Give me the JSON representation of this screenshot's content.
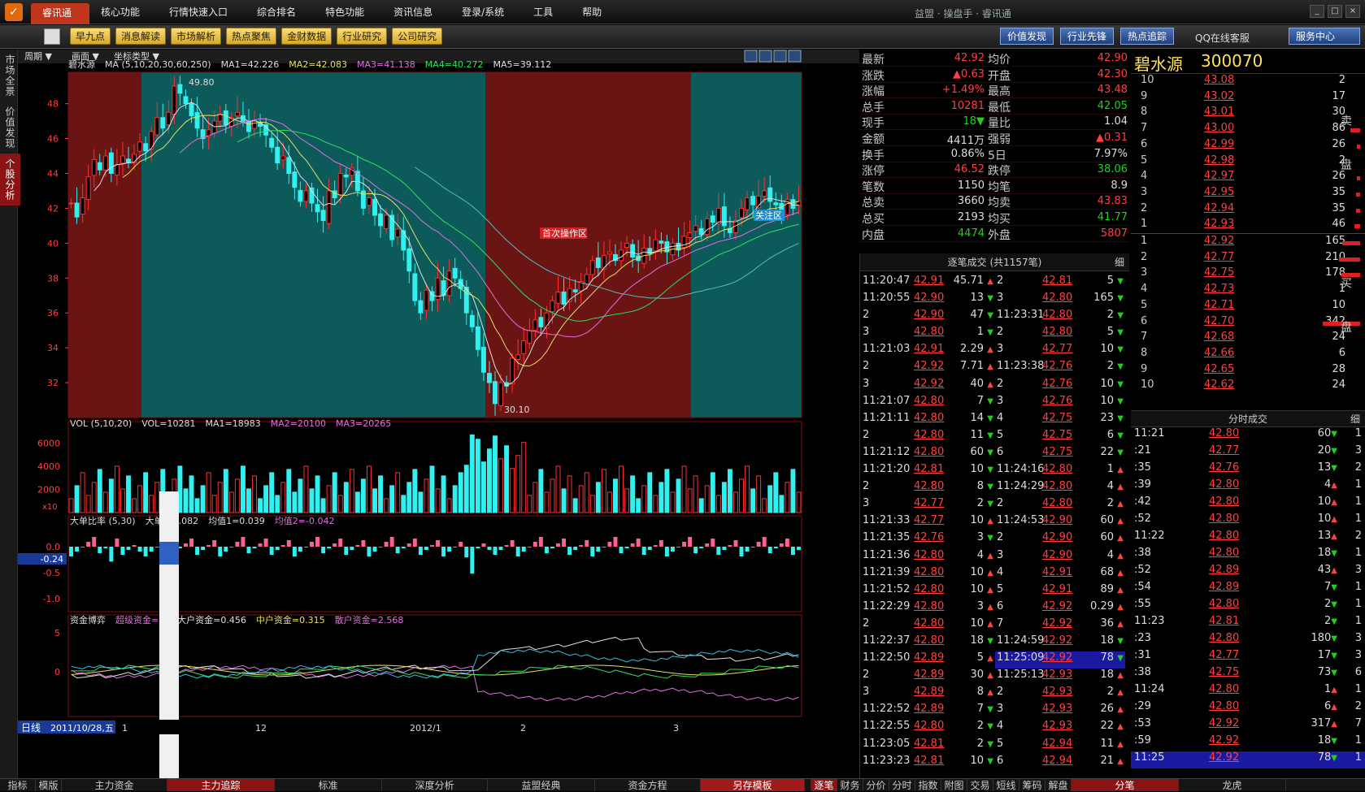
{
  "titlebar": {
    "menu": [
      "睿讯通",
      "核心功能",
      "行情快速入口",
      "综合排名",
      "特色功能",
      "资讯信息",
      "登录/系统",
      "工具",
      "帮助"
    ],
    "app_title": "益盟 · 操盘手 · 睿讯通"
  },
  "toolbar": {
    "quick": [
      "早九点",
      "消息解读",
      "市场解析",
      "热点聚焦",
      "金财数据",
      "行业研究",
      "公司研究"
    ],
    "right": [
      "价值发现",
      "行业先锋",
      "热点追踪"
    ],
    "qq": "QQ在线客服",
    "service": "服务中心"
  },
  "left_tabs": [
    "市场全景",
    "价值发现",
    "个股分析"
  ],
  "chart_toolbar": {
    "period": "周期",
    "picture": "画面",
    "coord": "坐标类型"
  },
  "chart": {
    "ma_header": [
      {
        "text": "碧水源",
        "color": "#ddd"
      },
      {
        "text": "MA (5,10,20,30,60,250)",
        "color": "#ddd"
      },
      {
        "text": "MA1=42.226",
        "color": "#ddd"
      },
      {
        "text": "MA2=42.083",
        "color": "#e8e060"
      },
      {
        "text": "MA3=41.138",
        "color": "#e070e0"
      },
      {
        "text": "MA4=40.272",
        "color": "#30e060"
      },
      {
        "text": "MA5=39.112",
        "color": "#e0e0e0"
      }
    ],
    "y_labels": [
      "48",
      "46",
      "44",
      "42",
      "40",
      "38",
      "36",
      "34",
      "32"
    ],
    "high_label": "49.80",
    "low_label": "30.10",
    "zone_label": "首次操作区",
    "watch_label": "关注区",
    "vol_header": [
      {
        "text": "VOL (5,10,20)",
        "color": "#ddd"
      },
      {
        "text": "VOL=10281",
        "color": "#ddd"
      },
      {
        "text": "MA1=18983",
        "color": "#ddd"
      },
      {
        "text": "MA2=20100",
        "color": "#e070e0"
      },
      {
        "text": "MA3=20265",
        "color": "#e070e0"
      }
    ],
    "vol_y_labels": [
      "6000",
      "4000",
      "2000"
    ],
    "vol_unit": "x10",
    "big_header": [
      {
        "text": "大单比率 (5,30)",
        "color": "#ddd"
      },
      {
        "text": "大单",
        "color": "#ddd"
      },
      {
        "text": "0.082",
        "color": "#ddd"
      },
      {
        "text": "均值1=0.039",
        "color": "#ddd"
      },
      {
        "text": "均值2=-0.042",
        "color": "#e070e0"
      }
    ],
    "big_y_labels": [
      "0.0",
      "-0.5",
      "-1.0"
    ],
    "big_current": "-0.24",
    "fund_header": [
      {
        "text": "资金博弈",
        "color": "#ddd"
      },
      {
        "text": "超级资金=-3",
        "color": "#e070e0"
      },
      {
        "text": "大户资金=0.456",
        "color": "#e0e0e0"
      },
      {
        "text": "中户资金=0.315",
        "color": "#e8e060"
      },
      {
        "text": "散户资金=2.568",
        "color": "#e070e0"
      }
    ],
    "fund_y_labels": [
      "5",
      "0"
    ],
    "x_axis": {
      "period": "日线",
      "date": "2011/10/28,五",
      "ticks": [
        "1",
        "12",
        "2012/1",
        "2",
        "3"
      ]
    }
  },
  "chart_data": {
    "type": "candlestick",
    "title": "碧水源",
    "close_series": [
      42.3,
      41.5,
      42.6,
      43.8,
      44.8,
      44.2,
      45.0,
      44.0,
      44.5,
      45.0,
      44.6,
      45.1,
      45.8,
      45.3,
      46.4,
      47.2,
      46.6,
      47.5,
      49.0,
      48.6,
      48.0,
      47.3,
      46.6,
      46.0,
      46.5,
      47.0,
      47.4,
      46.8,
      47.2,
      47.5,
      47.0,
      46.4,
      47.0,
      46.7,
      46.2,
      45.5,
      44.6,
      45.0,
      44.0,
      43.2,
      42.4,
      43.0,
      42.3,
      41.8,
      41.3,
      43.0,
      42.6,
      44.0,
      43.8,
      44.3,
      43.0,
      42.0,
      42.6,
      41.6,
      41.0,
      41.6,
      40.2,
      40.8,
      39.6,
      38.4,
      36.7,
      36.0,
      37.3,
      36.7,
      38.0,
      37.0,
      38.4,
      38.0,
      37.4,
      36.0,
      35.2,
      33.9,
      32.6,
      32.0,
      30.8,
      32.0,
      31.8,
      33.4,
      33.6,
      34.4,
      35.0,
      35.6,
      35.2,
      36.0,
      36.7,
      37.2,
      36.5,
      37.4,
      37.2,
      37.8,
      38.2,
      39.0,
      38.6,
      39.3,
      39.5,
      39.0,
      39.6,
      40.0,
      39.2,
      39.0,
      39.7,
      39.4,
      40.2,
      40.0,
      39.5,
      40.0,
      39.6,
      40.4,
      40.6,
      41.0,
      40.5,
      41.4,
      41.2,
      42.0,
      41.0,
      40.6,
      41.3,
      42.0,
      42.6,
      42.2,
      42.7,
      43.0,
      42.4,
      42.2,
      41.8,
      42.5,
      42.0,
      42.4
    ],
    "ylim": [
      30,
      49.8
    ],
    "price_high": 49.8,
    "price_low": 30.1,
    "vol_ylim": [
      0,
      7000
    ],
    "x_ticks": [
      "1",
      "12",
      "2012/1",
      "2",
      "3"
    ]
  },
  "quote": [
    {
      "l1": "最新",
      "v1": "42.92",
      "c1": "up",
      "l2": "均价",
      "v2": "42.90",
      "c2": "up"
    },
    {
      "l1": "涨跌",
      "v1": "▲0.63",
      "c1": "up",
      "l2": "开盘",
      "v2": "42.30",
      "c2": "up"
    },
    {
      "l1": "涨幅",
      "v1": "+1.49%",
      "c1": "up",
      "l2": "最高",
      "v2": "43.48",
      "c2": "up"
    },
    {
      "l1": "总手",
      "v1": "10281",
      "c1": "up",
      "l2": "最低",
      "v2": "42.05",
      "c2": "dn"
    },
    {
      "l1": "现手",
      "v1": "18▼",
      "c1": "dn",
      "l2": "量比",
      "v2": "1.04",
      "c2": "wt"
    },
    {
      "l1": "金额",
      "v1": "4411万",
      "c1": "wt",
      "l2": "强弱",
      "v2": "▲0.31",
      "c2": "up"
    },
    {
      "l1": "换手",
      "v1": "0.86%",
      "c1": "wt",
      "l2": "5日",
      "v2": "7.97%",
      "c2": "wt"
    },
    {
      "l1": "涨停",
      "v1": "46.52",
      "c1": "up",
      "l2": "跌停",
      "v2": "38.06",
      "c2": "dn"
    },
    {
      "l1": "笔数",
      "v1": "1150",
      "c1": "wt",
      "l2": "均笔",
      "v2": "8.9",
      "c2": "wt"
    },
    {
      "l1": "总卖",
      "v1": "3660",
      "c1": "wt",
      "l2": "均卖",
      "v2": "43.83",
      "c2": "up"
    },
    {
      "l1": "总买",
      "v1": "2193",
      "c1": "wt",
      "l2": "均买",
      "v2": "41.77",
      "c2": "dn"
    },
    {
      "l1": "内盘",
      "v1": "4474",
      "c1": "dn",
      "l2": "外盘",
      "v2": "5807",
      "c2": "up"
    }
  ],
  "ticks_header": "逐笔成交 (共1157笔)",
  "ticks_detail": "细",
  "ticks_left": [
    {
      "t": "11:20:47",
      "p": "42.91",
      "pc": "up",
      "v": "45.71",
      "a": "▲",
      "ac": "up"
    },
    {
      "t": "11:20:55",
      "p": "42.90",
      "pc": "up",
      "v": "13",
      "a": "▼",
      "ac": "dn"
    },
    {
      "t": "2",
      "p": "42.90",
      "pc": "up",
      "v": "47",
      "a": "▼",
      "ac": "dn"
    },
    {
      "t": "3",
      "p": "42.80",
      "pc": "up",
      "v": "1",
      "a": "▼",
      "ac": "dn"
    },
    {
      "t": "11:21:03",
      "p": "42.91",
      "pc": "up",
      "v": "2.29",
      "a": "▲",
      "ac": "up"
    },
    {
      "t": "2",
      "p": "42.92",
      "pc": "up",
      "v": "7.71",
      "a": "▲",
      "ac": "up"
    },
    {
      "t": "3",
      "p": "42.92",
      "pc": "up",
      "v": "40",
      "a": "▲",
      "ac": "up"
    },
    {
      "t": "11:21:07",
      "p": "42.80",
      "pc": "up",
      "v": "7",
      "a": "▼",
      "ac": "dn"
    },
    {
      "t": "11:21:11",
      "p": "42.80",
      "pc": "up",
      "v": "14",
      "a": "▼",
      "ac": "dn"
    },
    {
      "t": "2",
      "p": "42.80",
      "pc": "up",
      "v": "11",
      "a": "▼",
      "ac": "dn"
    },
    {
      "t": "11:21:12",
      "p": "42.80",
      "pc": "up",
      "v": "60",
      "a": "▼",
      "ac": "dn"
    },
    {
      "t": "11:21:20",
      "p": "42.81",
      "pc": "up",
      "v": "10",
      "a": "▼",
      "ac": "dn"
    },
    {
      "t": "2",
      "p": "42.80",
      "pc": "up",
      "v": "8",
      "a": "▼",
      "ac": "dn"
    },
    {
      "t": "3",
      "p": "42.77",
      "pc": "up",
      "v": "2",
      "a": "▼",
      "ac": "dn"
    },
    {
      "t": "11:21:33",
      "p": "42.77",
      "pc": "up",
      "v": "10",
      "a": "▲",
      "ac": "up"
    },
    {
      "t": "11:21:35",
      "p": "42.76",
      "pc": "up",
      "v": "3",
      "a": "▼",
      "ac": "dn"
    },
    {
      "t": "11:21:36",
      "p": "42.80",
      "pc": "up",
      "v": "4",
      "a": "▲",
      "ac": "up"
    },
    {
      "t": "11:21:39",
      "p": "42.80",
      "pc": "up",
      "v": "10",
      "a": "▲",
      "ac": "up"
    },
    {
      "t": "11:21:52",
      "p": "42.80",
      "pc": "up",
      "v": "10",
      "a": "▲",
      "ac": "up"
    },
    {
      "t": "11:22:29",
      "p": "42.80",
      "pc": "up",
      "v": "3",
      "a": "▲",
      "ac": "up"
    },
    {
      "t": "2",
      "p": "42.80",
      "pc": "up",
      "v": "10",
      "a": "▲",
      "ac": "up"
    },
    {
      "t": "11:22:37",
      "p": "42.80",
      "pc": "up",
      "v": "18",
      "a": "▼",
      "ac": "dn"
    },
    {
      "t": "11:22:50",
      "p": "42.89",
      "pc": "up",
      "v": "5",
      "a": "▲",
      "ac": "up"
    },
    {
      "t": "2",
      "p": "42.89",
      "pc": "up",
      "v": "30",
      "a": "▲",
      "ac": "up"
    },
    {
      "t": "3",
      "p": "42.89",
      "pc": "up",
      "v": "8",
      "a": "▲",
      "ac": "up"
    },
    {
      "t": "11:22:52",
      "p": "42.89",
      "pc": "up",
      "v": "7",
      "a": "▼",
      "ac": "dn"
    },
    {
      "t": "11:22:55",
      "p": "42.80",
      "pc": "up",
      "v": "2",
      "a": "▼",
      "ac": "dn"
    },
    {
      "t": "11:23:05",
      "p": "42.81",
      "pc": "up",
      "v": "2",
      "a": "▼",
      "ac": "dn"
    },
    {
      "t": "11:23:23",
      "p": "42.81",
      "pc": "up",
      "v": "10",
      "a": "▼",
      "ac": "dn"
    }
  ],
  "ticks_right": [
    {
      "t": "2",
      "p": "42.81",
      "pc": "up",
      "v": "5",
      "a": "▼",
      "ac": "dn"
    },
    {
      "t": "3",
      "p": "42.80",
      "pc": "up",
      "v": "165",
      "a": "▼",
      "ac": "dn"
    },
    {
      "t": "11:23:31",
      "p": "42.80",
      "pc": "up",
      "v": "2",
      "a": "▼",
      "ac": "dn"
    },
    {
      "t": "2",
      "p": "42.80",
      "pc": "up",
      "v": "5",
      "a": "▼",
      "ac": "dn"
    },
    {
      "t": "3",
      "p": "42.77",
      "pc": "up",
      "v": "10",
      "a": "▼",
      "ac": "dn"
    },
    {
      "t": "11:23:38",
      "p": "42.76",
      "pc": "up",
      "v": "2",
      "a": "▼",
      "ac": "dn"
    },
    {
      "t": "2",
      "p": "42.76",
      "pc": "up",
      "v": "10",
      "a": "▼",
      "ac": "dn"
    },
    {
      "t": "3",
      "p": "42.76",
      "pc": "up",
      "v": "10",
      "a": "▼",
      "ac": "dn"
    },
    {
      "t": "4",
      "p": "42.75",
      "pc": "up",
      "v": "23",
      "a": "▼",
      "ac": "dn"
    },
    {
      "t": "5",
      "p": "42.75",
      "pc": "up",
      "v": "6",
      "a": "▼",
      "ac": "dn"
    },
    {
      "t": "6",
      "p": "42.75",
      "pc": "up",
      "v": "22",
      "a": "▼",
      "ac": "dn"
    },
    {
      "t": "11:24:16",
      "p": "42.80",
      "pc": "up",
      "v": "1",
      "a": "▲",
      "ac": "up"
    },
    {
      "t": "11:24:29",
      "p": "42.80",
      "pc": "up",
      "v": "4",
      "a": "▲",
      "ac": "up"
    },
    {
      "t": "2",
      "p": "42.80",
      "pc": "up",
      "v": "2",
      "a": "▲",
      "ac": "up"
    },
    {
      "t": "11:24:53",
      "p": "42.90",
      "pc": "up",
      "v": "60",
      "a": "▲",
      "ac": "up"
    },
    {
      "t": "2",
      "p": "42.90",
      "pc": "up",
      "v": "60",
      "a": "▲",
      "ac": "up"
    },
    {
      "t": "3",
      "p": "42.90",
      "pc": "up",
      "v": "4",
      "a": "▲",
      "ac": "up"
    },
    {
      "t": "4",
      "p": "42.91",
      "pc": "up",
      "v": "68",
      "a": "▲",
      "ac": "up"
    },
    {
      "t": "5",
      "p": "42.91",
      "pc": "up",
      "v": "89",
      "a": "▲",
      "ac": "up"
    },
    {
      "t": "6",
      "p": "42.92",
      "pc": "up",
      "v": "0.29",
      "a": "▲",
      "ac": "up"
    },
    {
      "t": "7",
      "p": "42.92",
      "pc": "up",
      "v": "36",
      "a": "▲",
      "ac": "up"
    },
    {
      "t": "11:24:59",
      "p": "42.92",
      "pc": "up",
      "v": "18",
      "a": "▼",
      "ac": "dn"
    },
    {
      "t": "11:25:09",
      "p": "42.92",
      "pc": "up",
      "v": "78",
      "a": "▼",
      "ac": "dn",
      "hl": true
    },
    {
      "t": "11:25:13",
      "p": "42.93",
      "pc": "up",
      "v": "18",
      "a": "▲",
      "ac": "up"
    },
    {
      "t": "2",
      "p": "42.93",
      "pc": "up",
      "v": "2",
      "a": "▲",
      "ac": "up"
    },
    {
      "t": "3",
      "p": "42.93",
      "pc": "up",
      "v": "26",
      "a": "▲",
      "ac": "up"
    },
    {
      "t": "4",
      "p": "42.93",
      "pc": "up",
      "v": "22",
      "a": "▲",
      "ac": "up"
    },
    {
      "t": "5",
      "p": "42.94",
      "pc": "up",
      "v": "11",
      "a": "▲",
      "ac": "up"
    },
    {
      "t": "6",
      "p": "42.94",
      "pc": "up",
      "v": "21",
      "a": "▲",
      "ac": "up"
    }
  ],
  "book": {
    "name": "碧水源",
    "code": "300070",
    "sell_label": "卖盘",
    "buy_label": "买盘",
    "sells": [
      {
        "lv": "10",
        "p": "43.08",
        "v": "2",
        "bar": 0
      },
      {
        "lv": "9",
        "p": "43.02",
        "v": "17",
        "bar": 0
      },
      {
        "lv": "8",
        "p": "43.01",
        "v": "30",
        "bar": 0
      },
      {
        "lv": "7",
        "p": "43.00",
        "v": "86",
        "bar": 12
      },
      {
        "lv": "6",
        "p": "42.99",
        "v": "26",
        "bar": 4
      },
      {
        "lv": "5",
        "p": "42.98",
        "v": "2",
        "bar": 0
      },
      {
        "lv": "4",
        "p": "42.97",
        "v": "26",
        "bar": 4
      },
      {
        "lv": "3",
        "p": "42.95",
        "v": "35",
        "bar": 5
      },
      {
        "lv": "2",
        "p": "42.94",
        "v": "35",
        "bar": 5
      },
      {
        "lv": "1",
        "p": "42.93",
        "v": "46",
        "bar": 7
      }
    ],
    "buys": [
      {
        "lv": "1",
        "p": "42.92",
        "v": "165",
        "bar": 22
      },
      {
        "lv": "2",
        "p": "42.77",
        "v": "210",
        "bar": 26
      },
      {
        "lv": "3",
        "p": "42.75",
        "v": "178",
        "bar": 23
      },
      {
        "lv": "4",
        "p": "42.73",
        "v": "1",
        "bar": 0
      },
      {
        "lv": "5",
        "p": "42.71",
        "v": "10",
        "bar": 0
      },
      {
        "lv": "6",
        "p": "42.70",
        "v": "342",
        "bar": 46
      },
      {
        "lv": "7",
        "p": "42.68",
        "v": "24",
        "bar": 0
      },
      {
        "lv": "8",
        "p": "42.66",
        "v": "6",
        "bar": 0
      },
      {
        "lv": "9",
        "p": "42.65",
        "v": "28",
        "bar": 0
      },
      {
        "lv": "10",
        "p": "42.62",
        "v": "24",
        "bar": 0
      }
    ]
  },
  "minute_header": "分时成交",
  "minute_detail": "细",
  "minute": [
    {
      "t": "11:21",
      "p": "42.80",
      "pc": "up",
      "v": "60",
      "a": "▼",
      "ac": "dn",
      "n": "1"
    },
    {
      "t": ":21",
      "p": "42.77",
      "pc": "up",
      "v": "20",
      "a": "▼",
      "ac": "dn",
      "n": "3"
    },
    {
      "t": ":35",
      "p": "42.76",
      "pc": "up",
      "v": "13",
      "a": "▼",
      "ac": "dn",
      "n": "2"
    },
    {
      "t": ":39",
      "p": "42.80",
      "pc": "up",
      "v": "4",
      "a": "▲",
      "ac": "up",
      "n": "1"
    },
    {
      "t": ":42",
      "p": "42.80",
      "pc": "up",
      "v": "10",
      "a": "▲",
      "ac": "up",
      "n": "1"
    },
    {
      "t": ":52",
      "p": "42.80",
      "pc": "up",
      "v": "10",
      "a": "▲",
      "ac": "up",
      "n": "1"
    },
    {
      "t": "11:22",
      "p": "42.80",
      "pc": "up",
      "v": "13",
      "a": "▲",
      "ac": "up",
      "n": "2"
    },
    {
      "t": ":38",
      "p": "42.80",
      "pc": "up",
      "v": "18",
      "a": "▼",
      "ac": "dn",
      "n": "1"
    },
    {
      "t": ":52",
      "p": "42.89",
      "pc": "up",
      "v": "43",
      "a": "▲",
      "ac": "up",
      "n": "3"
    },
    {
      "t": ":54",
      "p": "42.89",
      "pc": "up",
      "v": "7",
      "a": "▼",
      "ac": "dn",
      "n": "1"
    },
    {
      "t": ":55",
      "p": "42.80",
      "pc": "up",
      "v": "2",
      "a": "▼",
      "ac": "dn",
      "n": "1"
    },
    {
      "t": "11:23",
      "p": "42.81",
      "pc": "up",
      "v": "2",
      "a": "▼",
      "ac": "dn",
      "n": "1"
    },
    {
      "t": ":23",
      "p": "42.80",
      "pc": "up",
      "v": "180",
      "a": "▼",
      "ac": "dn",
      "n": "3"
    },
    {
      "t": ":31",
      "p": "42.77",
      "pc": "up",
      "v": "17",
      "a": "▼",
      "ac": "dn",
      "n": "3"
    },
    {
      "t": ":38",
      "p": "42.75",
      "pc": "up",
      "v": "73",
      "a": "▼",
      "ac": "dn",
      "n": "6"
    },
    {
      "t": "11:24",
      "p": "42.80",
      "pc": "up",
      "v": "1",
      "a": "▲",
      "ac": "up",
      "n": "1"
    },
    {
      "t": ":29",
      "p": "42.80",
      "pc": "up",
      "v": "6",
      "a": "▲",
      "ac": "up",
      "n": "2"
    },
    {
      "t": ":53",
      "p": "42.92",
      "pc": "up",
      "v": "317",
      "a": "▲",
      "ac": "up",
      "n": "7"
    },
    {
      "t": ":59",
      "p": "42.92",
      "pc": "up",
      "v": "18",
      "a": "▼",
      "ac": "dn",
      "n": "1"
    },
    {
      "t": "11:25",
      "p": "42.92",
      "pc": "up",
      "v": "78",
      "a": "▼",
      "ac": "dn",
      "n": "1",
      "hl": true
    }
  ],
  "bottom_left": [
    "指标",
    "模版",
    "主力资金",
    "主力追踪",
    "标准",
    "深度分析",
    "益盟经典",
    "资金方程",
    "另存模板"
  ],
  "bottom_right": [
    "逐笔",
    "财务",
    "分价",
    "分时",
    "指数",
    "附图",
    "交易",
    "短线",
    "筹码",
    "解盘",
    "分笔",
    "龙虎"
  ]
}
